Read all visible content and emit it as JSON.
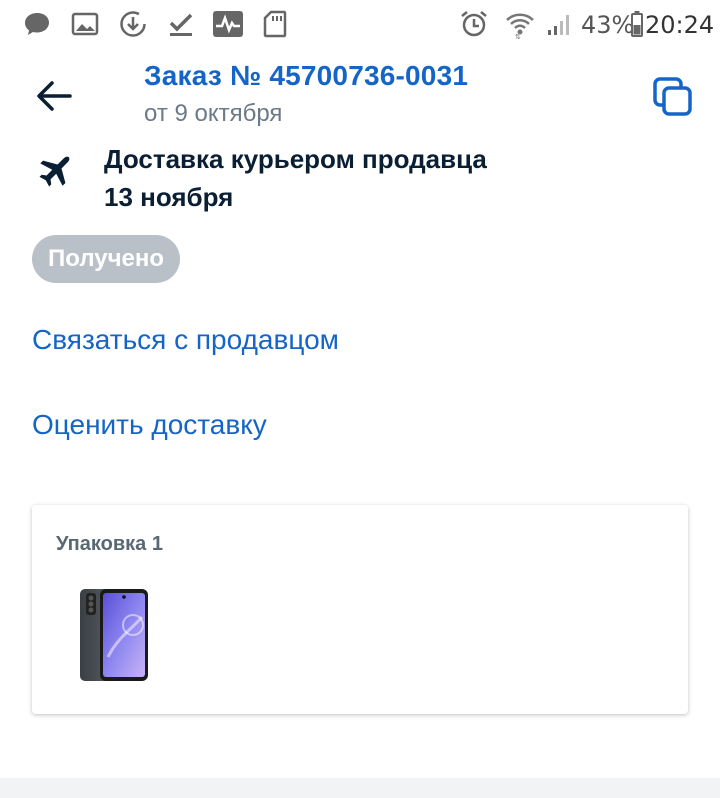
{
  "status_bar": {
    "battery": "43%",
    "time": "20:24",
    "icons": [
      "chat-icon",
      "image-icon",
      "download-icon",
      "check-icon",
      "activity-icon",
      "sd-card-icon",
      "alarm-icon",
      "wifi-icon",
      "signal-icon",
      "battery-icon"
    ]
  },
  "header": {
    "title": "Заказ № 45700736-0031",
    "date": "от 9 октября",
    "back_icon": "arrow-left-icon",
    "copy_icon": "copy-icon"
  },
  "delivery": {
    "icon": "airplane-icon",
    "method": "Доставка курьером продавца",
    "date": "13 ноября"
  },
  "status": {
    "label": "Получено",
    "color": "#b9c0c8"
  },
  "actions": {
    "contact_seller": "Связаться с продавцом",
    "rate_delivery": "Оценить доставку"
  },
  "package": {
    "title": "Упаковка 1",
    "items": [
      {
        "thumbnail": "smartphone-image"
      }
    ]
  },
  "colors": {
    "accent": "#1565c8",
    "text": "#0a1f33",
    "muted": "#6b7a89"
  }
}
